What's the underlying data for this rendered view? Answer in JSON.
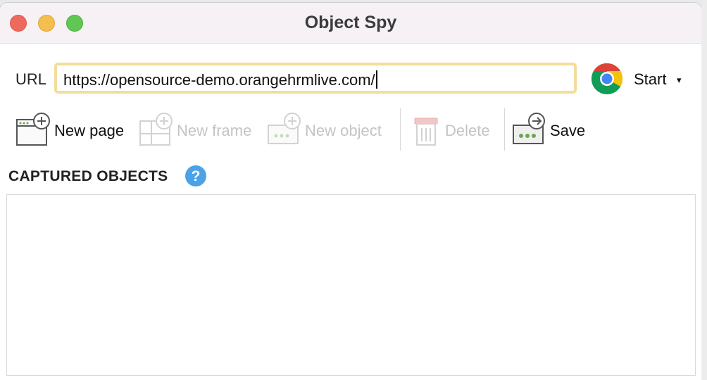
{
  "window": {
    "title": "Object Spy"
  },
  "url_bar": {
    "label": "URL",
    "value": "https://opensource-demo.orangehrmlive.com/"
  },
  "browser": {
    "icon": "chrome-icon",
    "start_label": "Start",
    "caret": "▾"
  },
  "toolbar": {
    "new_page": {
      "label": "New page",
      "icon": "new-page-icon",
      "enabled": true
    },
    "new_frame": {
      "label": "New frame",
      "icon": "new-frame-icon",
      "enabled": false
    },
    "new_object": {
      "label": "New object",
      "icon": "new-object-icon",
      "enabled": false
    },
    "delete": {
      "label": "Delete",
      "icon": "trash-icon",
      "enabled": false
    },
    "save": {
      "label": "Save",
      "icon": "save-icon",
      "enabled": true
    }
  },
  "captured_objects": {
    "title": "CAPTURED OBJECTS",
    "help_icon": "help-icon",
    "items": []
  },
  "colors": {
    "url_focus_border": "#f3dd9b",
    "help_blue": "#4aa3e8",
    "traffic_close": "#ee6a5e",
    "traffic_min": "#f5bf4f",
    "traffic_max": "#62c655"
  }
}
